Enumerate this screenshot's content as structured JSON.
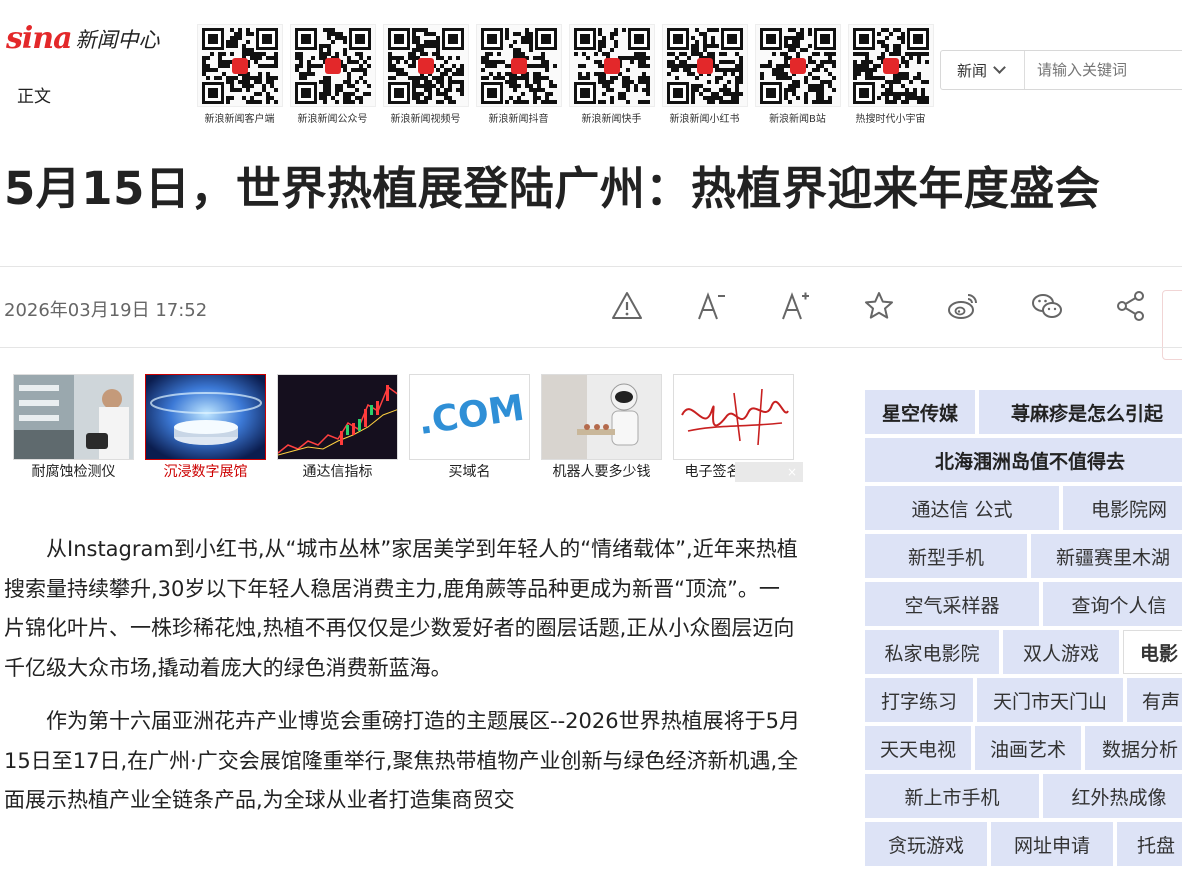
{
  "header": {
    "logo_sina": "sina",
    "logo_channel": "新闻中心",
    "breadcrumb": "正文",
    "qr_codes": [
      {
        "caption": "新浪新闻客户端"
      },
      {
        "caption": "新浪新闻公众号"
      },
      {
        "caption": "新浪新闻视频号"
      },
      {
        "caption": "新浪新闻抖音"
      },
      {
        "caption": "新浪新闻快手"
      },
      {
        "caption": "新浪新闻小红书"
      },
      {
        "caption": "新浪新闻B站"
      },
      {
        "caption": "热搜时代小宇宙"
      }
    ],
    "search": {
      "select_value": "新闻",
      "placeholder": "请输入关键词"
    }
  },
  "article": {
    "title": "5月15日，世界热植展登陆广州：热植界迎来年度盛会",
    "datetime": "2026年03月19日 17:52",
    "paragraphs": [
      "从Instagram到小红书,从“城市丛林”家居美学到年轻人的“情绪载体”,近年来热植搜索量持续攀升,30岁以下年轻人稳居消费主力,鹿角蕨等品种更成为新晋“顶流”。一片锦化叶片、一株珍稀花烛,热植不再仅仅是少数爱好者的圈层话题,正从小众圈层迈向千亿级大众市场,撬动着庞大的绿色消费新蓝海。",
      "作为第十六届亚洲花卉产业博览会重磅打造的主题展区--2026世界热植展将于5月15日至17日,在广州·广交会展馆隆重举行,聚焦热带植物产业创新与绿色经济新机遇,全面展示热植产业全链条产品,为全球从业者打造集商贸交"
    ]
  },
  "tools": [
    {
      "icon": "warning-icon"
    },
    {
      "icon": "font-smaller-icon"
    },
    {
      "icon": "font-larger-icon"
    },
    {
      "icon": "star-icon"
    },
    {
      "icon": "weibo-icon"
    },
    {
      "icon": "wechat-icon"
    },
    {
      "icon": "share-icon"
    }
  ],
  "ads": [
    {
      "caption": "耐腐蚀检测仪"
    },
    {
      "caption": "沉浸数字展馆"
    },
    {
      "caption": "通达信指标"
    },
    {
      "caption": "买域名"
    },
    {
      "caption": "机器人要多少钱"
    },
    {
      "caption": "电子签名生成器"
    }
  ],
  "ad_com_text": ".COM",
  "ad_close": "×",
  "keywords": [
    [
      "星空传媒",
      "荨麻疹是怎么引起"
    ],
    [
      "北海涠洲岛值不值得去"
    ],
    [
      "通达信  公式",
      "电影院网"
    ],
    [
      "新型手机",
      "新疆赛里木湖"
    ],
    [
      "空气采样器",
      "查询个人信"
    ],
    [
      "私家电影院",
      "双人游戏",
      "电影"
    ],
    [
      "打字练习",
      "天门市天门山",
      "有声"
    ],
    [
      "天天电视",
      "油画艺术",
      "数据分析"
    ],
    [
      "新上市手机",
      "红外热成像"
    ],
    [
      "贪玩游戏",
      "网址申请",
      "托盘"
    ]
  ],
  "colors": {
    "brand_red": "#e3282a",
    "keyword_bg": "#dde3f6"
  }
}
